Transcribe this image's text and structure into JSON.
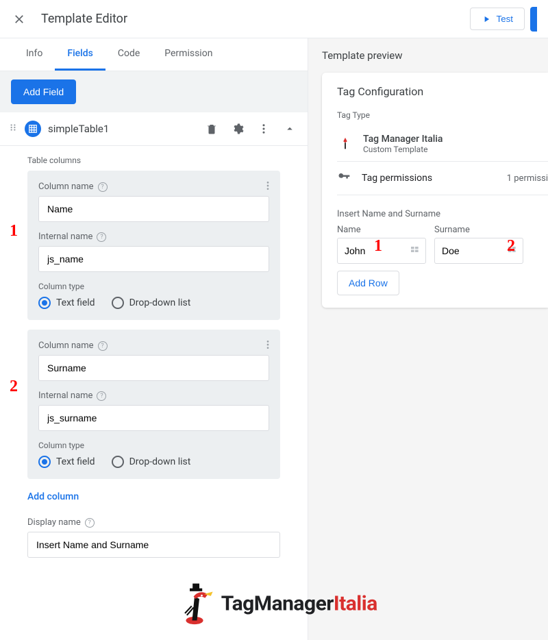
{
  "topbar": {
    "title": "Template Editor",
    "test_label": "Test"
  },
  "tabs": [
    "Info",
    "Fields",
    "Code",
    "Permission"
  ],
  "active_tab": 1,
  "add_field_label": "Add Field",
  "field": {
    "name": "simpleTable1",
    "section_table_columns": "Table columns",
    "label_column_name": "Column name",
    "label_internal_name": "Internal name",
    "label_column_type": "Column type",
    "radio_text_field": "Text field",
    "radio_dropdown": "Drop-down list",
    "columns": [
      {
        "column_name": "Name",
        "internal_name": "js_name",
        "type": "text"
      },
      {
        "column_name": "Surname",
        "internal_name": "js_surname",
        "type": "text"
      }
    ],
    "add_column_label": "Add column",
    "display_name_label": "Display name",
    "display_name_value": "Insert Name and Surname"
  },
  "preview": {
    "header": "Template preview",
    "card_title": "Tag Configuration",
    "tag_type_label": "Tag Type",
    "tag_name": "Tag Manager Italia",
    "tag_sub": "Custom Template",
    "permissions_label": "Tag permissions",
    "permissions_count": "1 permissi",
    "insert_label": "Insert Name and Surname",
    "col_headers": [
      "Name",
      "Surname"
    ],
    "row": {
      "name": "John",
      "surname": "Doe"
    },
    "add_row_label": "Add Row"
  },
  "brand": {
    "part1": "TagManager",
    "part2": "Italia"
  },
  "annotations": {
    "one": "1",
    "two": "2"
  }
}
